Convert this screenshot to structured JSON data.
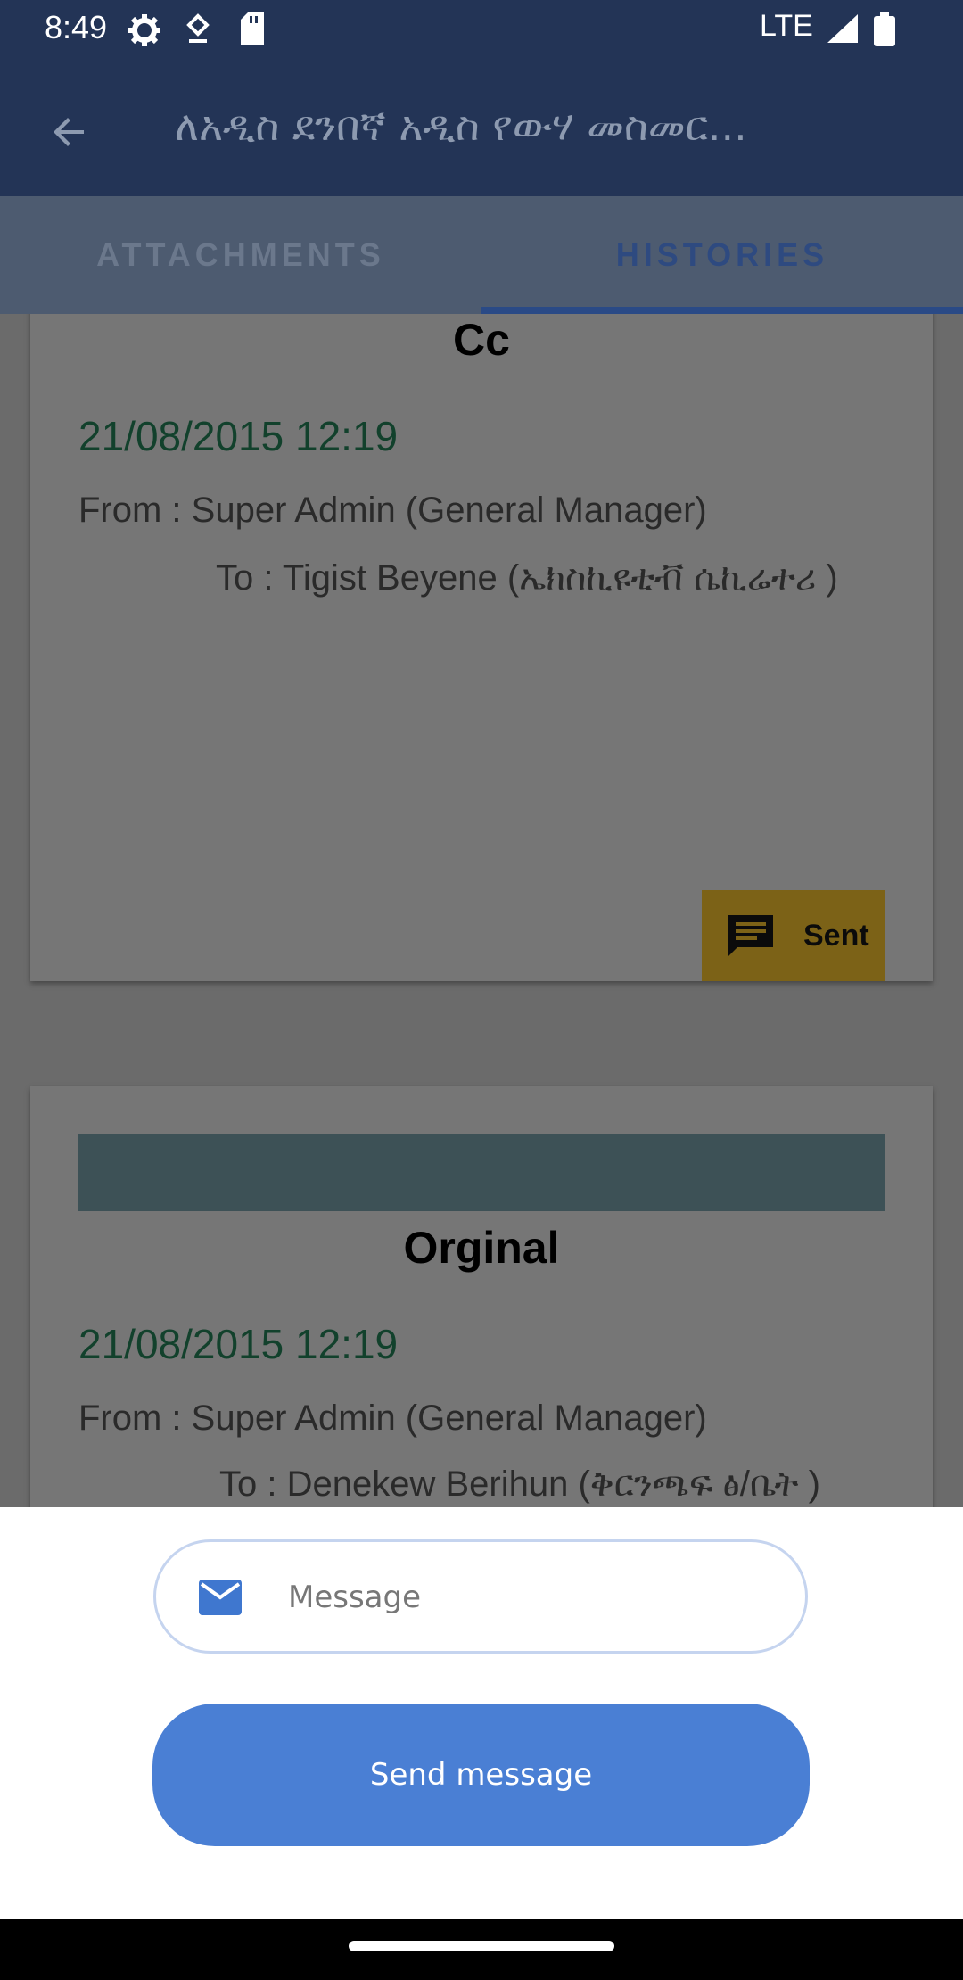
{
  "status_bar": {
    "time": "8:49",
    "network": "LTE",
    "icons": [
      "settings-icon",
      "location-icon",
      "sd-card-icon",
      "signal-icon",
      "battery-icon"
    ]
  },
  "app_bar": {
    "title": "ለአዲስ ደንበኛ አዲስ የውሃ መስመር...",
    "back_icon": "arrow-back-icon"
  },
  "tabs": [
    {
      "label": "ATTACHMENTS",
      "selected": false
    },
    {
      "label": "HISTORIES",
      "selected": true
    }
  ],
  "histories": [
    {
      "type": "Cc",
      "datetime": "21/08/2015 12:19",
      "from": "From : Super Admin (General Manager)",
      "to": "To : Tigist Beyene (ኤክስኪዩቲቭ ሴኪሬተሪ )",
      "status": "Sent",
      "status_icon": "message-icon"
    },
    {
      "type": "Orginal",
      "datetime": "21/08/2015 12:19",
      "from": "From : Super Admin (General Manager)",
      "to": "To : Denekew Berihun (ቅርንጫፍ ፅ/ቤት )"
    }
  ],
  "composer": {
    "placeholder": "Message",
    "send_label": "Send message",
    "mail_icon": "mail-icon"
  },
  "colors": {
    "app_bar": "#233456",
    "accent": "#4a7fd4",
    "date_text": "#12412c",
    "sent_badge": "#7c6217"
  }
}
